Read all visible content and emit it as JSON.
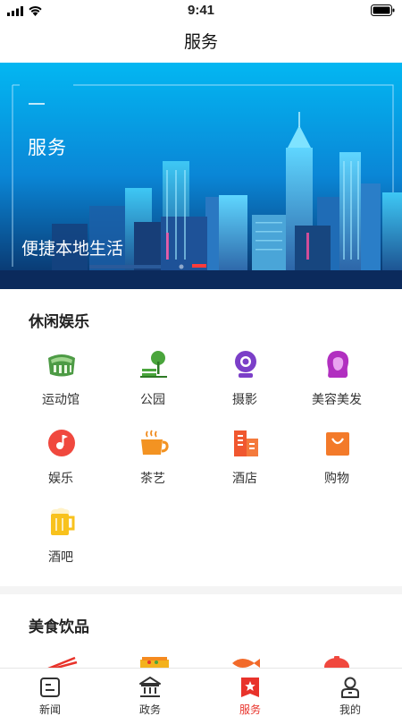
{
  "status_bar": {
    "time": "9:41"
  },
  "nav": {
    "title": "服务"
  },
  "banner": {
    "title": "服务",
    "subtitle": "便捷本地生活"
  },
  "leisure": {
    "title": "休闲娱乐",
    "items": [
      {
        "label": "运动馆",
        "icon": "stadium-icon"
      },
      {
        "label": "公园",
        "icon": "park-icon"
      },
      {
        "label": "摄影",
        "icon": "camera-icon"
      },
      {
        "label": "美容美发",
        "icon": "hair-salon-icon"
      },
      {
        "label": "娱乐",
        "icon": "music-icon"
      },
      {
        "label": "茶艺",
        "icon": "tea-cup-icon"
      },
      {
        "label": "酒店",
        "icon": "hotel-icon"
      },
      {
        "label": "购物",
        "icon": "shopping-bag-icon"
      },
      {
        "label": "酒吧",
        "icon": "beer-icon"
      }
    ]
  },
  "food": {
    "title": "美食饮品"
  },
  "tabbar": {
    "items": [
      {
        "label": "新闻",
        "icon": "news-icon"
      },
      {
        "label": "政务",
        "icon": "government-icon"
      },
      {
        "label": "服务",
        "icon": "service-icon"
      },
      {
        "label": "我的",
        "icon": "profile-icon"
      }
    ],
    "active": "服务"
  },
  "colors": {
    "accent": "#e8332b",
    "banner_top": "#00a2e8",
    "banner_bottom": "#0b2a5c"
  }
}
